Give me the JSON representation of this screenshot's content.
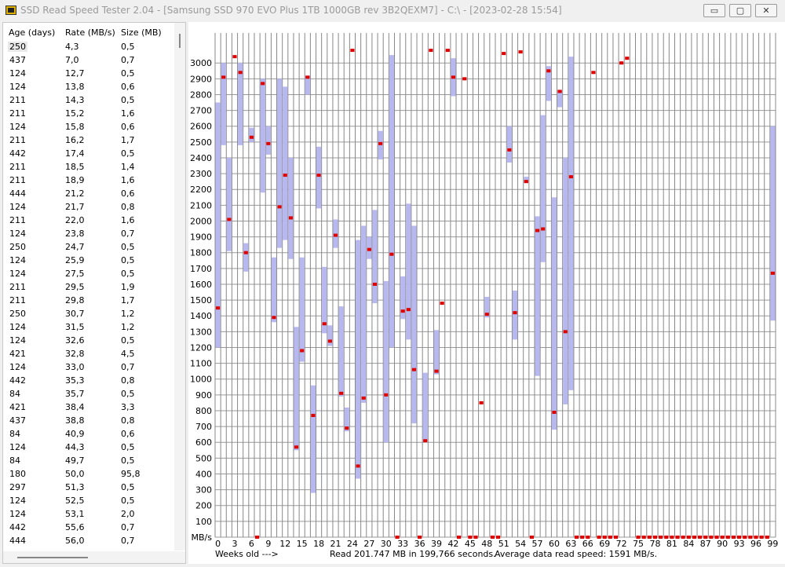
{
  "window": {
    "title": "SSD Read Speed Tester 2.04 - [Samsung SSD 970 EVO Plus 1TB 1000GB rev 3B2QEXM7] - C:\\ - [2023-02-28 15:54]",
    "buttons": {
      "minimize": "▭",
      "maximize": "▢",
      "close": "✕"
    }
  },
  "table": {
    "headers": [
      "Age (days)",
      "Rate (MB/s)",
      "Size (MB)"
    ],
    "rows": [
      [
        "250",
        "4,3",
        "0,5"
      ],
      [
        "437",
        "7,0",
        "0,7"
      ],
      [
        "124",
        "12,7",
        "0,5"
      ],
      [
        "124",
        "13,8",
        "0,6"
      ],
      [
        "211",
        "14,3",
        "0,5"
      ],
      [
        "211",
        "15,2",
        "1,6"
      ],
      [
        "124",
        "15,8",
        "0,6"
      ],
      [
        "211",
        "16,2",
        "1,7"
      ],
      [
        "442",
        "17,4",
        "0,5"
      ],
      [
        "211",
        "18,5",
        "1,4"
      ],
      [
        "211",
        "18,9",
        "1,6"
      ],
      [
        "444",
        "21,2",
        "0,6"
      ],
      [
        "124",
        "21,7",
        "0,8"
      ],
      [
        "211",
        "22,0",
        "1,6"
      ],
      [
        "124",
        "23,8",
        "0,7"
      ],
      [
        "250",
        "24,7",
        "0,5"
      ],
      [
        "124",
        "25,9",
        "0,5"
      ],
      [
        "124",
        "27,5",
        "0,5"
      ],
      [
        "211",
        "29,5",
        "1,9"
      ],
      [
        "211",
        "29,8",
        "1,7"
      ],
      [
        "250",
        "30,7",
        "1,2"
      ],
      [
        "124",
        "31,5",
        "1,2"
      ],
      [
        "124",
        "32,6",
        "0,5"
      ],
      [
        "421",
        "32,8",
        "4,5"
      ],
      [
        "124",
        "33,0",
        "0,7"
      ],
      [
        "442",
        "35,3",
        "0,8"
      ],
      [
        "84",
        "35,7",
        "0,5"
      ],
      [
        "421",
        "38,4",
        "3,3"
      ],
      [
        "437",
        "38,8",
        "0,8"
      ],
      [
        "84",
        "40,9",
        "0,6"
      ],
      [
        "124",
        "44,3",
        "0,5"
      ],
      [
        "84",
        "49,7",
        "0,5"
      ],
      [
        "180",
        "50,0",
        "95,8"
      ],
      [
        "297",
        "51,3",
        "0,5"
      ],
      [
        "124",
        "52,5",
        "0,5"
      ],
      [
        "124",
        "53,1",
        "2,0"
      ],
      [
        "442",
        "55,6",
        "0,7"
      ],
      [
        "444",
        "56,0",
        "0,7"
      ]
    ]
  },
  "chart_data": {
    "type": "bar",
    "ylabel": "MB/s",
    "xlabel": "Weeks old --->",
    "ylim": [
      0,
      3000
    ],
    "yticks": [
      100,
      200,
      300,
      400,
      500,
      600,
      700,
      800,
      900,
      1000,
      1100,
      1200,
      1300,
      1400,
      1500,
      1600,
      1700,
      1800,
      1900,
      2000,
      2100,
      2200,
      2300,
      2400,
      2500,
      2600,
      2700,
      2800,
      2900,
      3000
    ],
    "xticks": [
      0,
      3,
      6,
      9,
      12,
      15,
      18,
      21,
      24,
      27,
      30,
      33,
      36,
      39,
      42,
      45,
      48,
      51,
      54,
      57,
      60,
      63,
      66,
      69,
      72,
      75,
      78,
      81,
      84,
      87,
      90,
      93,
      96,
      99
    ],
    "grid": true,
    "series_colors": {
      "range": "#b8b8f0",
      "average": "#e00000"
    },
    "weeks": [
      {
        "w": 0,
        "min": 1200,
        "max": 2750,
        "avg": 1450
      },
      {
        "w": 1,
        "min": 2480,
        "max": 3000,
        "avg": 2910
      },
      {
        "w": 2,
        "min": 1810,
        "max": 2400,
        "avg": 2010
      },
      {
        "w": 3,
        "min": null,
        "max": null,
        "avg": 3040
      },
      {
        "w": 4,
        "min": 2480,
        "max": 3000,
        "avg": 2940
      },
      {
        "w": 5,
        "min": 1680,
        "max": 1860,
        "avg": 1800
      },
      {
        "w": 6,
        "min": 2500,
        "max": 2590,
        "avg": 2530
      },
      {
        "w": 7,
        "min": null,
        "max": null,
        "avg": 0
      },
      {
        "w": 8,
        "min": 2180,
        "max": 2900,
        "avg": 2870
      },
      {
        "w": 9,
        "min": 2420,
        "max": 2600,
        "avg": 2490
      },
      {
        "w": 10,
        "min": 1360,
        "max": 1770,
        "avg": 1390
      },
      {
        "w": 11,
        "min": 1830,
        "max": 2900,
        "avg": 2090
      },
      {
        "w": 12,
        "min": 1880,
        "max": 2850,
        "avg": 2290
      },
      {
        "w": 13,
        "min": 1760,
        "max": 2400,
        "avg": 2020
      },
      {
        "w": 14,
        "min": 550,
        "max": 1330,
        "avg": 570
      },
      {
        "w": 15,
        "min": 1110,
        "max": 1770,
        "avg": 1180
      },
      {
        "w": 16,
        "min": 2800,
        "max": 2920,
        "avg": 2910
      },
      {
        "w": 17,
        "min": 280,
        "max": 960,
        "avg": 770
      },
      {
        "w": 18,
        "min": 2080,
        "max": 2470,
        "avg": 2290
      },
      {
        "w": 19,
        "min": 1290,
        "max": 1710,
        "avg": 1350
      },
      {
        "w": 20,
        "min": 1210,
        "max": 1340,
        "avg": 1240
      },
      {
        "w": 21,
        "min": 1830,
        "max": 2010,
        "avg": 1910
      },
      {
        "w": 22,
        "min": 890,
        "max": 1460,
        "avg": 910
      },
      {
        "w": 23,
        "min": 670,
        "max": 820,
        "avg": 690
      },
      {
        "w": 24,
        "min": null,
        "max": null,
        "avg": 3080
      },
      {
        "w": 25,
        "min": 370,
        "max": 1880,
        "avg": 450
      },
      {
        "w": 26,
        "min": 850,
        "max": 1970,
        "avg": 880
      },
      {
        "w": 27,
        "min": 1760,
        "max": 1900,
        "avg": 1820
      },
      {
        "w": 28,
        "min": 1480,
        "max": 2070,
        "avg": 1600
      },
      {
        "w": 29,
        "min": 2390,
        "max": 2570,
        "avg": 2490
      },
      {
        "w": 30,
        "min": 600,
        "max": 1620,
        "avg": 900
      },
      {
        "w": 31,
        "min": 1200,
        "max": 3050,
        "avg": 1790
      },
      {
        "w": 32,
        "min": null,
        "max": null,
        "avg": 0
      },
      {
        "w": 33,
        "min": 1380,
        "max": 1650,
        "avg": 1430
      },
      {
        "w": 34,
        "min": 1250,
        "max": 2110,
        "avg": 1440
      },
      {
        "w": 35,
        "min": 720,
        "max": 1970,
        "avg": 1060
      },
      {
        "w": 36,
        "min": null,
        "max": null,
        "avg": 0
      },
      {
        "w": 37,
        "min": 600,
        "max": 1040,
        "avg": 610
      },
      {
        "w": 38,
        "min": null,
        "max": null,
        "avg": 3080
      },
      {
        "w": 39,
        "min": 1030,
        "max": 1310,
        "avg": 1050
      },
      {
        "w": 40,
        "min": null,
        "max": null,
        "avg": 1480
      },
      {
        "w": 41,
        "min": null,
        "max": null,
        "avg": 3080
      },
      {
        "w": 42,
        "min": 2790,
        "max": 3030,
        "avg": 2910
      },
      {
        "w": 43,
        "min": null,
        "max": null,
        "avg": 0
      },
      {
        "w": 44,
        "min": null,
        "max": null,
        "avg": 2900
      },
      {
        "w": 45,
        "min": null,
        "max": null,
        "avg": 0
      },
      {
        "w": 46,
        "min": null,
        "max": null,
        "avg": 0
      },
      {
        "w": 47,
        "min": null,
        "max": null,
        "avg": 850
      },
      {
        "w": 48,
        "min": 1390,
        "max": 1520,
        "avg": 1410
      },
      {
        "w": 49,
        "min": null,
        "max": null,
        "avg": 0
      },
      {
        "w": 50,
        "min": null,
        "max": null,
        "avg": 0
      },
      {
        "w": 51,
        "min": null,
        "max": null,
        "avg": 3060
      },
      {
        "w": 52,
        "min": 2370,
        "max": 2600,
        "avg": 2450
      },
      {
        "w": 53,
        "min": 1250,
        "max": 1560,
        "avg": 1420
      },
      {
        "w": 54,
        "min": null,
        "max": null,
        "avg": 3070
      },
      {
        "w": 55,
        "min": 2240,
        "max": 2280,
        "avg": 2250
      },
      {
        "w": 56,
        "min": null,
        "max": null,
        "avg": 0
      },
      {
        "w": 57,
        "min": 1020,
        "max": 2030,
        "avg": 1940
      },
      {
        "w": 58,
        "min": 1740,
        "max": 2670,
        "avg": 1950
      },
      {
        "w": 59,
        "min": 2760,
        "max": 2980,
        "avg": 2950
      },
      {
        "w": 60,
        "min": 680,
        "max": 2150,
        "avg": 790
      },
      {
        "w": 61,
        "min": 2720,
        "max": 2830,
        "avg": 2820
      },
      {
        "w": 62,
        "min": 840,
        "max": 2400,
        "avg": 1300
      },
      {
        "w": 63,
        "min": 930,
        "max": 3040,
        "avg": 2280
      },
      {
        "w": 64,
        "min": null,
        "max": null,
        "avg": 0
      },
      {
        "w": 65,
        "min": null,
        "max": null,
        "avg": 0
      },
      {
        "w": 66,
        "min": null,
        "max": null,
        "avg": 0
      },
      {
        "w": 67,
        "min": null,
        "max": null,
        "avg": 2940
      },
      {
        "w": 68,
        "min": null,
        "max": null,
        "avg": 0
      },
      {
        "w": 69,
        "min": null,
        "max": null,
        "avg": 0
      },
      {
        "w": 70,
        "min": null,
        "max": null,
        "avg": 0
      },
      {
        "w": 71,
        "min": null,
        "max": null,
        "avg": 0
      },
      {
        "w": 72,
        "min": null,
        "max": null,
        "avg": 3000
      },
      {
        "w": 73,
        "min": null,
        "max": null,
        "avg": 3030
      },
      {
        "w": 75,
        "min": null,
        "max": null,
        "avg": 0
      },
      {
        "w": 76,
        "min": null,
        "max": null,
        "avg": 0
      },
      {
        "w": 77,
        "min": null,
        "max": null,
        "avg": 0
      },
      {
        "w": 78,
        "min": null,
        "max": null,
        "avg": 0
      },
      {
        "w": 79,
        "min": null,
        "max": null,
        "avg": 0
      },
      {
        "w": 80,
        "min": null,
        "max": null,
        "avg": 0
      },
      {
        "w": 81,
        "min": null,
        "max": null,
        "avg": 0
      },
      {
        "w": 82,
        "min": null,
        "max": null,
        "avg": 0
      },
      {
        "w": 83,
        "min": null,
        "max": null,
        "avg": 0
      },
      {
        "w": 84,
        "min": null,
        "max": null,
        "avg": 0
      },
      {
        "w": 85,
        "min": null,
        "max": null,
        "avg": 0
      },
      {
        "w": 86,
        "min": null,
        "max": null,
        "avg": 0
      },
      {
        "w": 87,
        "min": null,
        "max": null,
        "avg": 0
      },
      {
        "w": 88,
        "min": null,
        "max": null,
        "avg": 0
      },
      {
        "w": 89,
        "min": null,
        "max": null,
        "avg": 0
      },
      {
        "w": 90,
        "min": null,
        "max": null,
        "avg": 0
      },
      {
        "w": 91,
        "min": null,
        "max": null,
        "avg": 0
      },
      {
        "w": 92,
        "min": null,
        "max": null,
        "avg": 0
      },
      {
        "w": 93,
        "min": null,
        "max": null,
        "avg": 0
      },
      {
        "w": 94,
        "min": null,
        "max": null,
        "avg": 0
      },
      {
        "w": 95,
        "min": null,
        "max": null,
        "avg": 0
      },
      {
        "w": 96,
        "min": null,
        "max": null,
        "avg": 0
      },
      {
        "w": 97,
        "min": null,
        "max": null,
        "avg": 0
      },
      {
        "w": 98,
        "min": null,
        "max": null,
        "avg": 0
      },
      {
        "w": 99,
        "min": 1370,
        "max": 2600,
        "avg": 1670
      }
    ]
  },
  "status": {
    "read_summary": "Read 201.747 MB in 199,766 seconds.",
    "average": "Average data read speed: 1591 MB/s."
  }
}
